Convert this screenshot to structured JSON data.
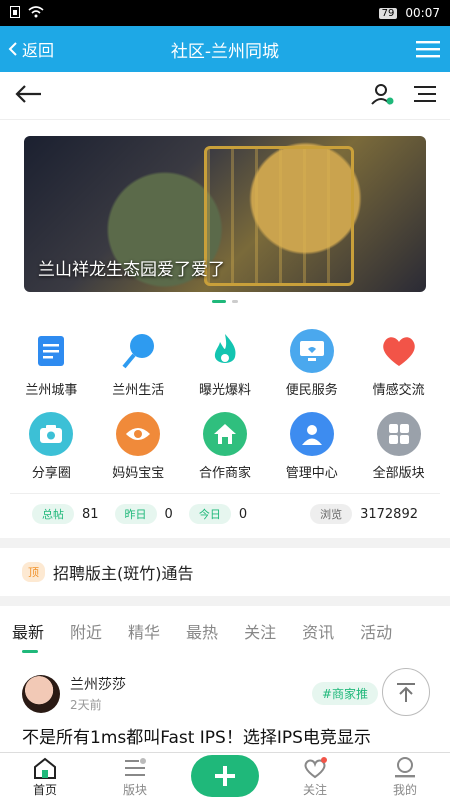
{
  "statusbar": {
    "battery": "79",
    "time": "00:07"
  },
  "topbar": {
    "back_label": "返回",
    "title": "社区-兰州同城"
  },
  "banner": {
    "caption": "兰山祥龙生态园爱了爱了"
  },
  "grid": [
    {
      "label": "兰州城事",
      "icon": "document-icon",
      "color": "#2e8bf0"
    },
    {
      "label": "兰州生活",
      "icon": "balloon-icon",
      "color": "#2e9bf0"
    },
    {
      "label": "曝光爆料",
      "icon": "flame-icon",
      "color": "#13c4b0"
    },
    {
      "label": "便民服务",
      "icon": "monitor-icon",
      "color": "#4aa8ee"
    },
    {
      "label": "情感交流",
      "icon": "heart-icon",
      "color": "#f25448"
    },
    {
      "label": "分享圈",
      "icon": "camera-icon",
      "color": "#3cc0d6"
    },
    {
      "label": "妈妈宝宝",
      "icon": "eye-icon",
      "color": "#f08a3a"
    },
    {
      "label": "合作商家",
      "icon": "home-icon",
      "color": "#2fbf7e"
    },
    {
      "label": "管理中心",
      "icon": "person-icon",
      "color": "#3d8cf0"
    },
    {
      "label": "全部版块",
      "icon": "grid-icon",
      "color": "#9aa1aa"
    }
  ],
  "stats": {
    "total_label": "总帖",
    "total": "81",
    "yesterday_label": "昨日",
    "yesterday": "0",
    "today_label": "今日",
    "today": "0",
    "views_label": "浏览",
    "views": "3172892"
  },
  "notice": {
    "badge": "顶",
    "text": "招聘版主(斑竹)通告"
  },
  "tabs": [
    "最新",
    "附近",
    "精华",
    "最热",
    "关注",
    "资讯",
    "活动"
  ],
  "post": {
    "author": "兰州莎莎",
    "time": "2天前",
    "tag": "#商家推",
    "title": "不是所有1ms都叫Fast IPS！选择IPS电竞显示"
  },
  "bottomnav": {
    "home": "首页",
    "boards": "版块",
    "follow": "关注",
    "mine": "我的"
  }
}
